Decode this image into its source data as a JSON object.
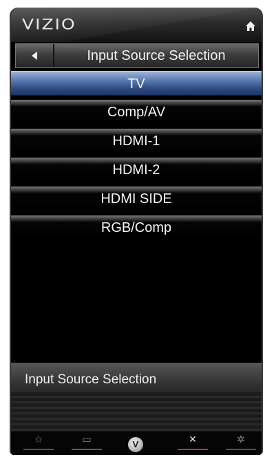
{
  "header": {
    "logo": "VIZIO",
    "home_icon": "home-icon"
  },
  "title_bar": {
    "back_icon": "back-arrow-icon",
    "title": "Input Source Selection"
  },
  "menu": {
    "selected": "TV",
    "items": [
      {
        "label": "TV"
      },
      {
        "label": "Comp/AV"
      },
      {
        "label": "HDMI-1"
      },
      {
        "label": "HDMI-2"
      },
      {
        "label": "HDMI SIDE"
      },
      {
        "label": "RGB/Comp"
      }
    ]
  },
  "info_panel": {
    "text": "Input Source Selection"
  },
  "bottom_bar": {
    "buttons": [
      {
        "icon": "star-icon",
        "glyph": "☆",
        "accent": "#555555"
      },
      {
        "icon": "widgets-icon",
        "glyph": "▭",
        "accent": "#1f69c8"
      },
      {
        "icon": "vizio-v-icon",
        "glyph": "V",
        "accent": "#bdbdbd"
      },
      {
        "icon": "close-icon",
        "glyph": "✕",
        "accent": "#d0245c"
      },
      {
        "icon": "gear-icon",
        "glyph": "✲",
        "accent": "#555555"
      }
    ]
  },
  "colors": {
    "selected_item": "#3a5a92",
    "background": "#000000",
    "text": "#f4f4f4"
  }
}
